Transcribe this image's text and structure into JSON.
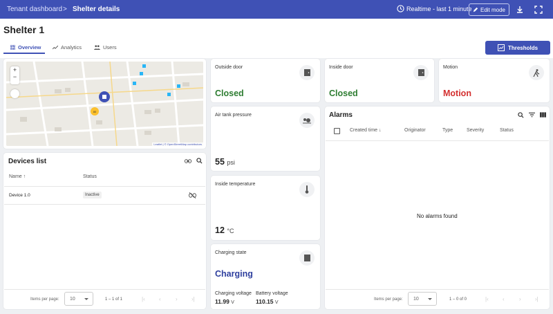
{
  "topbar": {
    "breadcrumb_root": "Tenant dashboard",
    "breadcrumb_sep": ">",
    "breadcrumb_current": "Shelter details",
    "timewindow": "Realtime - last 1 minute",
    "edit_mode": "Edit mode",
    "icons": [
      "clock-icon",
      "pencil-icon",
      "download-icon",
      "fullscreen-icon"
    ]
  },
  "page": {
    "title": "Shelter 1",
    "tabs": [
      {
        "label": "Overview",
        "icon": "grid-icon",
        "active": true
      },
      {
        "label": "Analytics",
        "icon": "trend-icon",
        "active": false
      },
      {
        "label": "Users",
        "icon": "users-icon",
        "active": false
      }
    ],
    "thresholds_button": "Thresholds"
  },
  "map": {
    "zoom_in": "+",
    "zoom_out": "−",
    "attribution": "Leaflet | © OpenStreetMap contributors"
  },
  "outside_door": {
    "label": "Outside door",
    "value": "Closed",
    "color": "#2e7d32"
  },
  "inside_door": {
    "label": "Inside door",
    "value": "Closed",
    "color": "#2e7d32"
  },
  "motion": {
    "label": "Motion",
    "value": "Motion",
    "color": "#d32f2f"
  },
  "air_tank": {
    "label": "Air tank pressure",
    "value": "55",
    "unit": "psi"
  },
  "inside_temp": {
    "label": "Inside temperature",
    "value": "12",
    "unit": "°C"
  },
  "charging": {
    "label": "Charging state",
    "value": "Charging",
    "color": "#2e3f9e",
    "charging_voltage_label": "Charging voltage",
    "charging_voltage_value": "11.99",
    "charging_voltage_unit": "V",
    "battery_voltage_label": "Battery voltage",
    "battery_voltage_value": "110.15",
    "battery_voltage_unit": "V"
  },
  "devices": {
    "title": "Devices list",
    "columns": [
      "Name",
      "Status"
    ],
    "rows": [
      {
        "name": "Device 1.0",
        "status": "Inactive"
      }
    ],
    "items_per_page_label": "Items per page:",
    "items_per_page": "10",
    "range": "1 – 1 of 1"
  },
  "alarms": {
    "title": "Alarms",
    "columns": [
      "Created time",
      "Originator",
      "Type",
      "Severity",
      "Status"
    ],
    "empty_text": "No alarms found",
    "items_per_page_label": "Items per page:",
    "items_per_page": "10",
    "range": "1 – 0 of 0"
  }
}
